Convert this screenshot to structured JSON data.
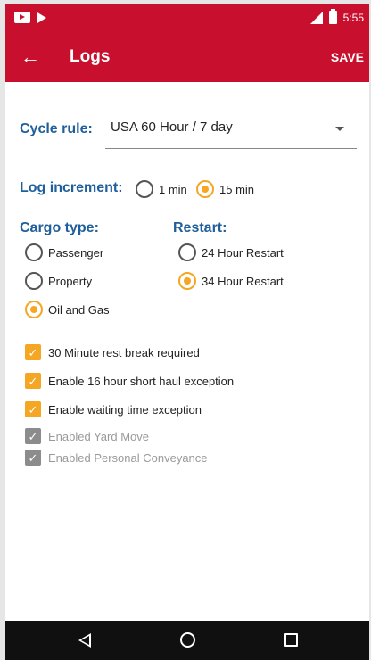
{
  "status_bar": {
    "time": "5:55"
  },
  "app_bar": {
    "title": "Logs",
    "save_label": "SAVE"
  },
  "cycle_rule": {
    "label": "Cycle rule:",
    "value": "USA 60 Hour / 7 day"
  },
  "log_increment": {
    "label": "Log increment:",
    "options": [
      {
        "label": "1 min",
        "selected": false
      },
      {
        "label": "15 min",
        "selected": true
      }
    ]
  },
  "cargo_type": {
    "label": "Cargo type:",
    "options": [
      {
        "label": "Passenger",
        "selected": false
      },
      {
        "label": "Property",
        "selected": false
      },
      {
        "label": "Oil and Gas",
        "selected": true
      }
    ]
  },
  "restart": {
    "label": "Restart:",
    "options": [
      {
        "label": "24 Hour Restart",
        "selected": false
      },
      {
        "label": "34 Hour Restart",
        "selected": true
      }
    ]
  },
  "checkboxes": [
    {
      "label": "30 Minute rest break required",
      "checked": true,
      "enabled": true
    },
    {
      "label": "Enable 16 hour short haul exception",
      "checked": true,
      "enabled": true
    },
    {
      "label": "Enable waiting time exception",
      "checked": true,
      "enabled": true
    },
    {
      "label": "Enabled Yard Move",
      "checked": true,
      "enabled": false
    },
    {
      "label": "Enabled Personal Conveyance",
      "checked": true,
      "enabled": false
    }
  ],
  "colors": {
    "app_bar": "#c8102e",
    "accent": "#f5a623",
    "label_blue": "#1f5f9b"
  }
}
